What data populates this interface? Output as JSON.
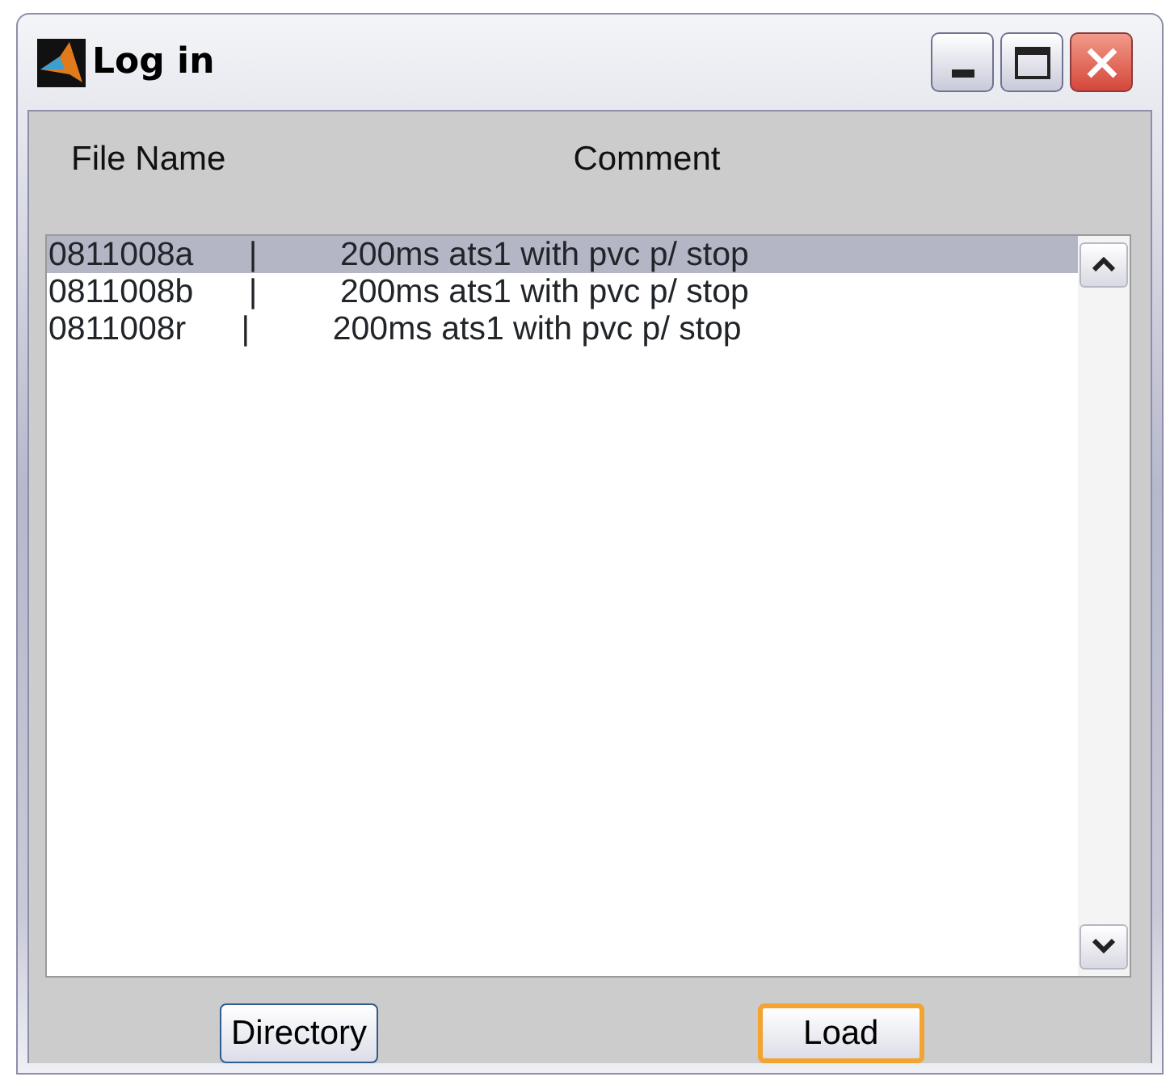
{
  "window": {
    "title": "Log in"
  },
  "columns": [
    "File Name",
    "Comment"
  ],
  "list": {
    "items": [
      {
        "text": "0811008a      |         200ms ats1 with pvc p/ stop",
        "selected": true
      },
      {
        "text": "0811008b      |         200ms ats1 with pvc p/ stop",
        "selected": false
      },
      {
        "text": "0811008r      |         200ms ats1 with pvc p/ stop",
        "selected": false
      }
    ]
  },
  "buttons": [
    {
      "label": "Directory",
      "default": false
    },
    {
      "label": "Load",
      "default": true
    }
  ]
}
